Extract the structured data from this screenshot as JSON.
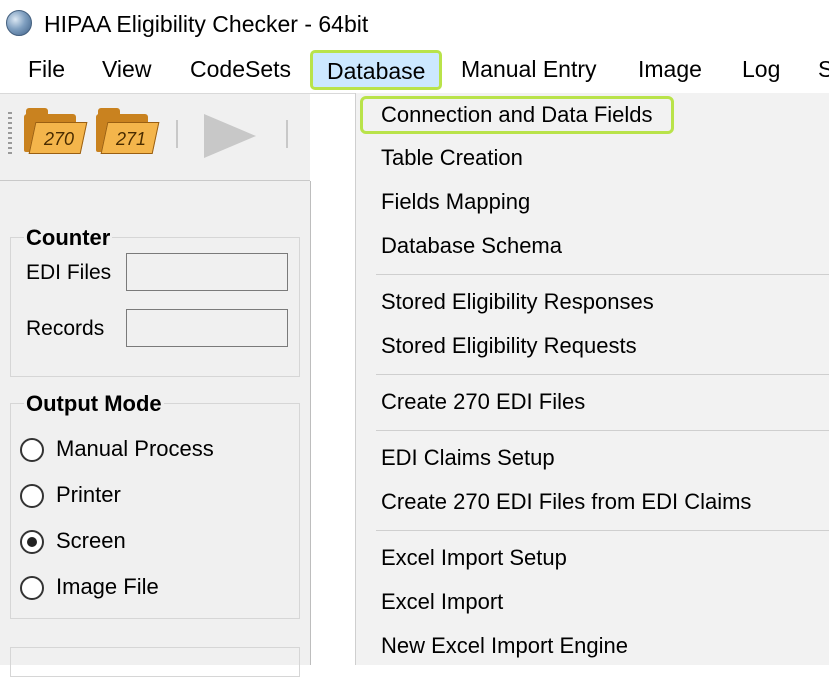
{
  "window": {
    "title": "HIPAA Eligibility Checker - 64bit",
    "accent_highlight": "#b9e34a",
    "menu_open_bg": "#cce8ff"
  },
  "menubar": {
    "items": [
      "File",
      "View",
      "CodeSets",
      "Database",
      "Manual Entry",
      "Image",
      "Log",
      "S"
    ],
    "open_item": "Database"
  },
  "toolbar": {
    "folder_270_label": "270",
    "folder_271_label": "271"
  },
  "counter": {
    "title": "Counter",
    "edi_files_label": "EDI Files",
    "edi_files_value": "",
    "records_label": "Records",
    "records_value": ""
  },
  "output_mode": {
    "title": "Output Mode",
    "options": [
      {
        "label": "Manual Process",
        "checked": false
      },
      {
        "label": "Printer",
        "checked": false
      },
      {
        "label": "Screen",
        "checked": true
      },
      {
        "label": "Image File",
        "checked": false
      }
    ]
  },
  "database_menu": {
    "items": [
      "Connection and Data Fields",
      "Table Creation",
      "Fields Mapping",
      "Database Schema",
      "Stored Eligibility Responses",
      "Stored Eligibility Requests",
      "Create 270 EDI Files",
      "EDI Claims Setup",
      "Create 270 EDI Files from EDI Claims",
      "Excel Import Setup",
      "Excel Import",
      "New Excel Import Engine"
    ],
    "highlighted": "Connection and Data Fields"
  }
}
